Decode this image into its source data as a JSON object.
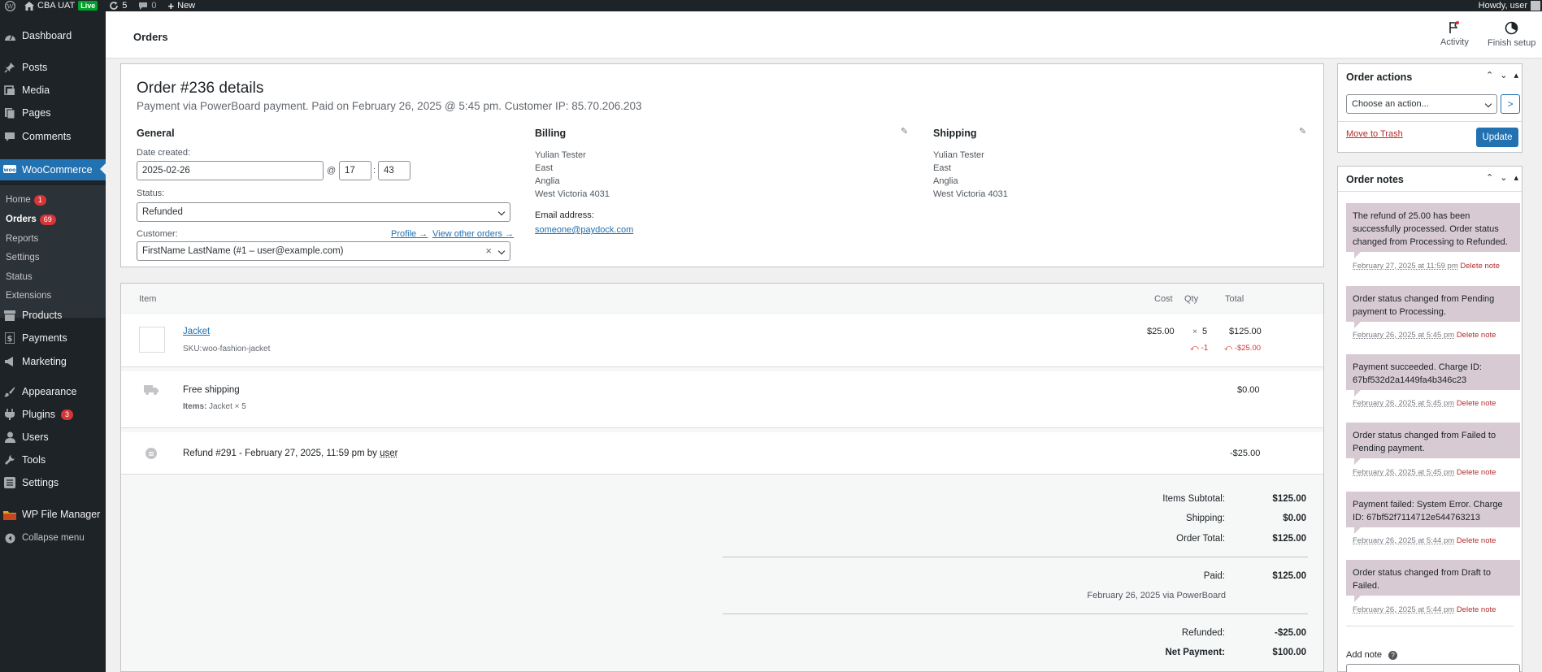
{
  "admin_bar": {
    "site_name": "CBA UAT",
    "live_badge": "Live",
    "updates_count": "5",
    "comments_count": "0",
    "new_label": "New",
    "howdy": "Howdy, user"
  },
  "sidebar": {
    "items": [
      {
        "label": "Dashboard",
        "icon": "dashboard-icon"
      },
      {
        "label": "Posts",
        "icon": "pin-icon"
      },
      {
        "label": "Media",
        "icon": "media-icon"
      },
      {
        "label": "Pages",
        "icon": "page-icon"
      },
      {
        "label": "Comments",
        "icon": "comment-icon"
      },
      {
        "label": "WooCommerce",
        "icon": "woo-icon"
      },
      {
        "label": "Products",
        "icon": "archive-icon"
      },
      {
        "label": "Payments",
        "icon": "dollar-icon"
      },
      {
        "label": "Marketing",
        "icon": "megaphone-icon"
      },
      {
        "label": "Appearance",
        "icon": "brush-icon"
      },
      {
        "label": "Plugins",
        "icon": "plug-icon",
        "badge": "3"
      },
      {
        "label": "Users",
        "icon": "user-icon"
      },
      {
        "label": "Tools",
        "icon": "wrench-icon"
      },
      {
        "label": "Settings",
        "icon": "settings-icon"
      },
      {
        "label": "WP File Manager",
        "icon": "folder-icon"
      },
      {
        "label": "Collapse menu",
        "icon": "collapse-icon"
      }
    ],
    "submenu": [
      {
        "label": "Home",
        "badge": "1"
      },
      {
        "label": "Orders",
        "badge": "69"
      },
      {
        "label": "Reports"
      },
      {
        "label": "Settings"
      },
      {
        "label": "Status"
      },
      {
        "label": "Extensions"
      }
    ]
  },
  "header": {
    "title": "Orders",
    "activity_label": "Activity",
    "finish_setup_label": "Finish setup"
  },
  "order": {
    "title": "Order #236 details",
    "meta": "Payment via PowerBoard payment. Paid on February 26, 2025 @ 5:45 pm. Customer IP: 85.70.206.203",
    "general": {
      "heading": "General",
      "date_label": "Date created:",
      "date_value": "2025-02-26",
      "at": "@",
      "hour": "17",
      "colon": ":",
      "minute": "43",
      "status_label": "Status:",
      "status_value": "Refunded",
      "customer_label": "Customer:",
      "profile_link": "Profile →",
      "other_orders_link": "View other orders →",
      "customer_value": "FirstName LastName (#1 – user@example.com)",
      "clear_mark": "×"
    },
    "billing": {
      "heading": "Billing",
      "address": [
        "Yulian Tester",
        "East",
        "Anglia",
        "West Victoria 4031"
      ],
      "email_label": "Email address:",
      "email": "someone@paydock.com"
    },
    "shipping": {
      "heading": "Shipping",
      "address": [
        "Yulian Tester",
        "East",
        "Anglia",
        "West Victoria 4031"
      ]
    }
  },
  "items": {
    "headers": {
      "item": "Item",
      "cost": "Cost",
      "qty": "Qty",
      "total": "Total"
    },
    "line": {
      "name": "Jacket",
      "sku_label": "SKU:",
      "sku": "woo-fashion-jacket",
      "cost": "$25.00",
      "qty_prefix": "×",
      "qty": "5",
      "total": "$125.00",
      "refund_qty": "-1",
      "refund_total": "-$25.00"
    },
    "shipping_line": {
      "name": "Free shipping",
      "items_label": "Items:",
      "items_value": "Jacket × 5",
      "total": "$0.00"
    },
    "refund_line": {
      "text": "Refund #291 - February 27, 2025, 11:59 pm by",
      "user": "user",
      "total": "-$25.00"
    },
    "totals": {
      "subtotal_label": "Items Subtotal:",
      "subtotal": "$125.00",
      "shipping_label": "Shipping:",
      "shipping": "$0.00",
      "order_total_label": "Order Total:",
      "order_total": "$125.00",
      "paid_label": "Paid:",
      "paid": "$125.00",
      "paid_note": "February 26, 2025 via PowerBoard",
      "refunded_label": "Refunded:",
      "refunded": "-$25.00",
      "net_label": "Net Payment:",
      "net": "$100.00"
    }
  },
  "order_actions": {
    "title": "Order actions",
    "select_placeholder": "Choose an action...",
    "go_glyph": ">",
    "trash_link": "Move to Trash",
    "update_label": "Update"
  },
  "order_notes": {
    "title": "Order notes",
    "notes": [
      {
        "text": "The refund of 25.00 has been successfully processed. Order status changed from Processing to Refunded.",
        "date": "February 27, 2025 at 11:59 pm",
        "delete": "Delete note"
      },
      {
        "text": "Order status changed from Pending payment to Processing.",
        "date": "February 26, 2025 at 5:45 pm",
        "delete": "Delete note"
      },
      {
        "text": "Payment succeeded. Charge ID: 67bf532d2a1449fa4b346c23",
        "date": "February 26, 2025 at 5:45 pm",
        "delete": "Delete note"
      },
      {
        "text": "Order status changed from Failed to Pending payment.",
        "date": "February 26, 2025 at 5:45 pm",
        "delete": "Delete note"
      },
      {
        "text": "Payment failed: System Error. Charge ID: 67bf52f7114712e544763213",
        "date": "February 26, 2025 at 5:44 pm",
        "delete": "Delete note"
      },
      {
        "text": "Order status changed from Draft to Failed.",
        "date": "February 26, 2025 at 5:44 pm",
        "delete": "Delete note"
      }
    ],
    "add_note_label": "Add note",
    "help_glyph": "?"
  }
}
